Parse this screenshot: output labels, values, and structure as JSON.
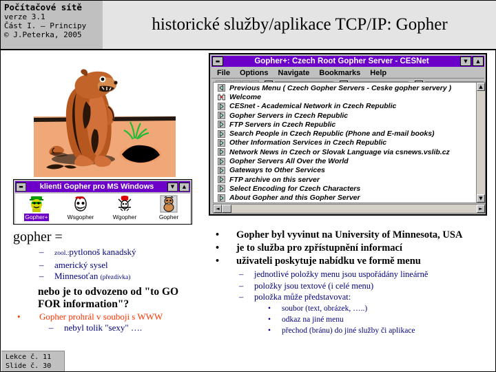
{
  "header": {
    "brand_title": "Počítačové sítě",
    "brand_lines": [
      "verze 3.1",
      "Část I. – Principy",
      "© J.Peterka, 2005"
    ],
    "slide_title": "historické služby/aplikace TCP/IP: Gopher"
  },
  "icon_window": {
    "title": "klienti Gopher pro MS Windows",
    "minimize_label": "▬",
    "restore_label": "▼",
    "maximize_label": "▲",
    "icons": [
      {
        "name": "Gopher+",
        "selected": true
      },
      {
        "name": "Wsgopher",
        "selected": false
      },
      {
        "name": "Wgopher",
        "selected": false
      },
      {
        "name": "Gopher",
        "selected": false
      }
    ]
  },
  "gopher_window": {
    "title": "Gopher+: Czech Root Gopher Server - CESNet",
    "minimize_label": "▬",
    "restore_label": "▼",
    "maximize_label": "▲",
    "menu": [
      "File",
      "Options",
      "Navigate",
      "Bookmarks",
      "Help"
    ],
    "toolbar": {
      "icons": [
        "globe-icon",
        "binoculars-icon",
        "home-icon",
        "forward-icon",
        "back-icon"
      ],
      "bookmark_labels": [
        "1",
        "2",
        "3"
      ],
      "field_values": [
        "",
        "",
        ""
      ]
    },
    "list_items": [
      {
        "icon": "back-arrow-icon",
        "label": "Previous Menu ( Czech Gopher Servers - Ceske gopher servery )"
      },
      {
        "icon": "binoculars-icon",
        "label": "Welcome"
      },
      {
        "icon": "folder-arrow-icon",
        "label": "CESnet - Academical Network in Czech Republic"
      },
      {
        "icon": "folder-arrow-icon",
        "label": "Gopher Servers in Czech Republic"
      },
      {
        "icon": "folder-arrow-icon",
        "label": "FTP Servers in Czech Republic"
      },
      {
        "icon": "folder-arrow-icon",
        "label": "Search People in Czech Republic (Phone and E-mail books)"
      },
      {
        "icon": "folder-arrow-icon",
        "label": "Other Information Services in Czech Republic"
      },
      {
        "icon": "folder-arrow-icon",
        "label": "Network News in Czech or Slovak Language via csnews.vslib.cz"
      },
      {
        "icon": "folder-arrow-icon",
        "label": "Gopher Servers All Over the World"
      },
      {
        "icon": "folder-arrow-icon",
        "label": "Gateways to Other Services"
      },
      {
        "icon": "folder-arrow-icon",
        "label": "FTP archive on this server"
      },
      {
        "icon": "folder-arrow-icon",
        "label": "Select Encoding for Czech Characters"
      },
      {
        "icon": "folder-arrow-icon",
        "label": "About Gopher and this Gopher Server"
      }
    ],
    "scroll": {
      "up": "▲",
      "down": "▼",
      "left": "◄",
      "right": "►"
    }
  },
  "left_text": {
    "heading": "gopher =",
    "items": [
      {
        "prefix": "zool.:",
        "text": "pytlonoš kanadský"
      },
      {
        "prefix": "",
        "text": "americký sysel"
      },
      {
        "prefix": "",
        "text": "Minnesoťan",
        "suffix": "(přezdívka)"
      }
    ],
    "question": "nebo je to odvozeno od \"to GO FOR information\"?",
    "red_note": "Gopher prohrál v souboji s WWW",
    "red_sub": "nebyl tolik \"sexy\" ….",
    "dash": "–",
    "bullet": "•"
  },
  "right_text": {
    "bullets": [
      "Gopher byl vyvinut na University of Minnesota, USA",
      "je to služba pro zpřístupnění informací",
      "uživateli poskytuje nabídku ve formě menu"
    ],
    "subs": [
      "jednotlivé položky menu jsou uspořádány lineárně",
      "položky jsou textové (i celé menu)",
      "položka může představovat:"
    ],
    "subsubs": [
      "soubor (text, obrázek, …..)",
      "odkaz na jiné menu",
      "přechod (bránu) do jiné služby či aplikace"
    ],
    "bullet": "•",
    "dash": "–"
  },
  "footer": {
    "lekce": "Lekce č. 11",
    "slide": "Slide č. 30"
  },
  "colors": {
    "titlebar": "#6d00c8",
    "sub_text": "#000080",
    "red_accent": "#ff3300",
    "chrome": "#c0c0c0",
    "header_bg": "#e4e4e4"
  }
}
